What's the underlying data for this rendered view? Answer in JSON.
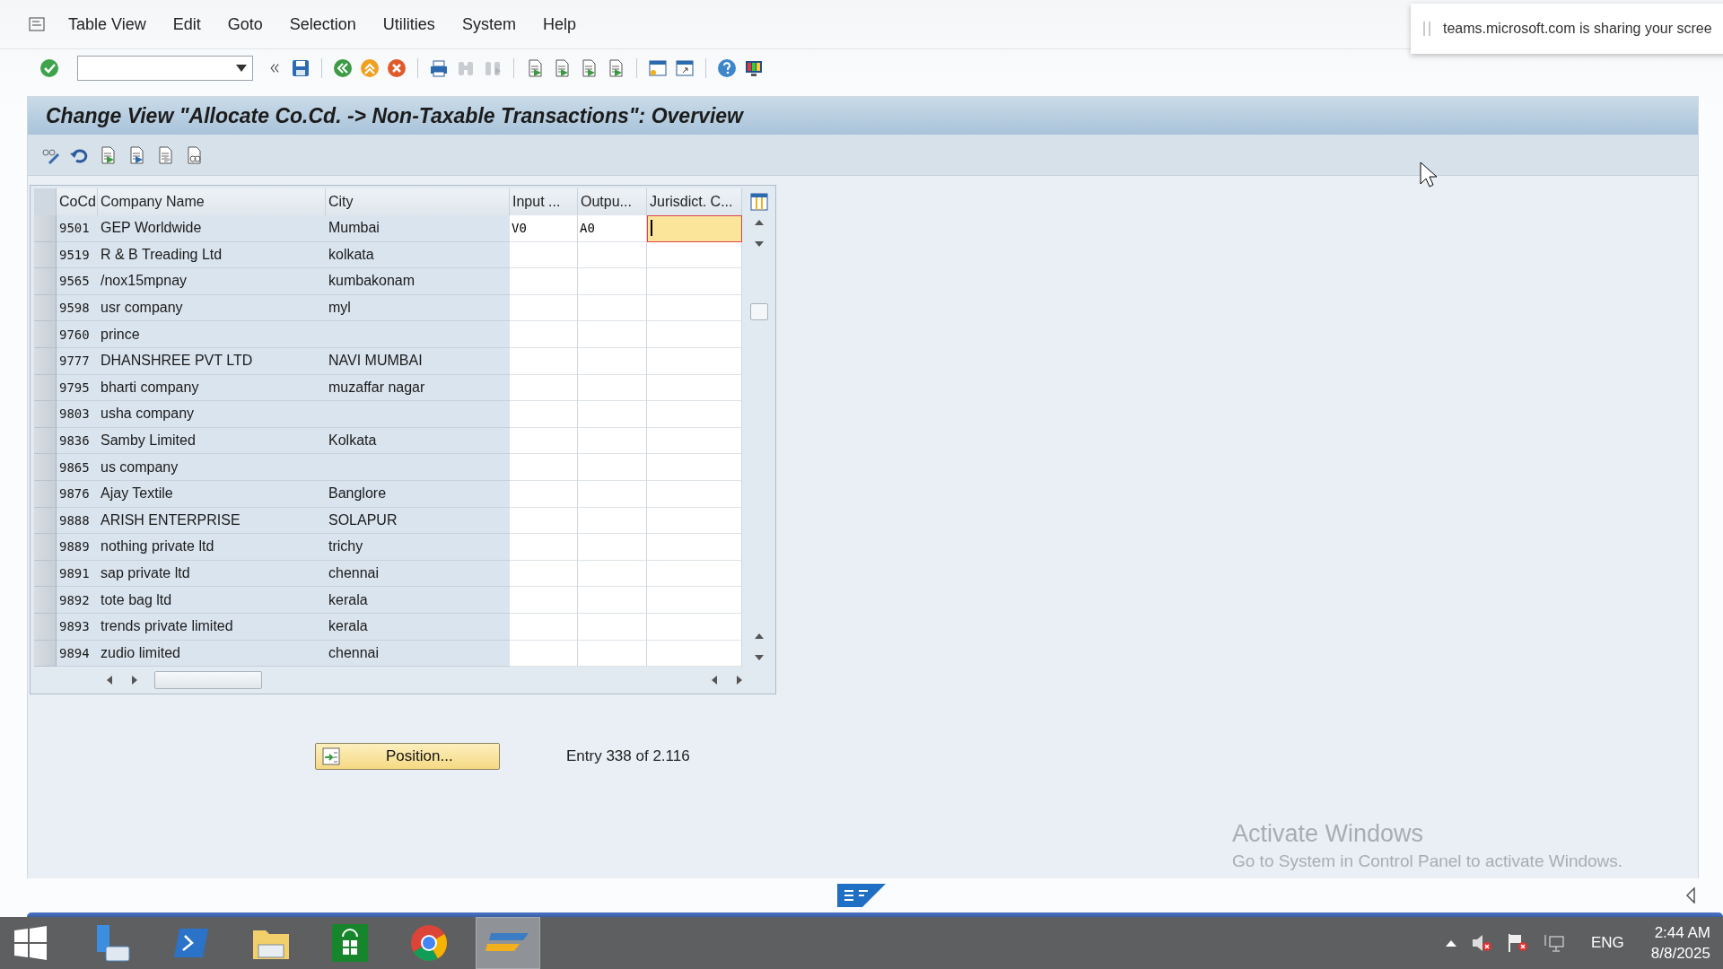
{
  "menu": [
    "Table View",
    "Edit",
    "Goto",
    "Selection",
    "Utilities",
    "System",
    "Help"
  ],
  "title": "Change View \"Allocate Co.Cd. -> Non-Taxable Transactions\": Overview",
  "table": {
    "columns": [
      "CoCd",
      "Company Name",
      "City",
      "Input ...",
      "Outpu...",
      "Jurisdict. C..."
    ],
    "rows": [
      {
        "cocd": "9501",
        "name": "GEP Worldwide",
        "city": "Mumbai",
        "input": "V0",
        "output": "A0",
        "jurisdiction_focused": true
      },
      {
        "cocd": "9519",
        "name": "R & B Treading Ltd",
        "city": "kolkata",
        "jurisdiction_focused": false
      },
      {
        "cocd": "9565",
        "name": "/nox15mpnay",
        "city": "kumbakonam",
        "jurisdiction_focused": false
      },
      {
        "cocd": "9598",
        "name": "usr company",
        "city": "myl",
        "jurisdiction_focused": false
      },
      {
        "cocd": "9760",
        "name": "prince",
        "jurisdiction_focused": false
      },
      {
        "cocd": "9777",
        "name": "DHANSHREE PVT LTD",
        "city": "NAVI MUMBAI",
        "jurisdiction_focused": false
      },
      {
        "cocd": "9795",
        "name": "bharti company",
        "city": "muzaffar nagar",
        "jurisdiction_focused": false
      },
      {
        "cocd": "9803",
        "name": "usha company",
        "jurisdiction_focused": false
      },
      {
        "cocd": "9836",
        "name": "Samby Limited",
        "city": "Kolkata",
        "jurisdiction_focused": false
      },
      {
        "cocd": "9865",
        "name": "us company",
        "jurisdiction_focused": false
      },
      {
        "cocd": "9876",
        "name": "Ajay Textile",
        "city": "Banglore",
        "jurisdiction_focused": false
      },
      {
        "cocd": "9888",
        "name": "ARISH ENTERPRISE",
        "city": "SOLAPUR",
        "jurisdiction_focused": false
      },
      {
        "cocd": "9889",
        "name": "nothing private ltd",
        "city": "trichy",
        "jurisdiction_focused": false
      },
      {
        "cocd": "9891",
        "name": "sap private ltd",
        "city": "chennai",
        "jurisdiction_focused": false
      },
      {
        "cocd": "9892",
        "name": "tote bag ltd",
        "city": "kerala",
        "jurisdiction_focused": false
      },
      {
        "cocd": "9893",
        "name": "trends private limited",
        "city": "kerala",
        "jurisdiction_focused": false
      },
      {
        "cocd": "9894",
        "name": "zudio limited",
        "city": "chennai",
        "jurisdiction_focused": false
      }
    ]
  },
  "position_button": "Position...",
  "entry_info": "Entry 338 of 2.116",
  "notification": "teams.microsoft.com is sharing your scree",
  "activation": {
    "title": "Activate Windows",
    "text": "Go to System in Control Panel to activate Windows."
  },
  "taskbar": {
    "apps": [
      {
        "kind": "server",
        "selected": false
      },
      {
        "kind": "shell",
        "selected": false
      },
      {
        "kind": "folder",
        "selected": false
      },
      {
        "kind": "store",
        "selected": false
      },
      {
        "kind": "chrome",
        "selected": false
      },
      {
        "kind": "sap",
        "selected": true
      }
    ],
    "language": "ENG",
    "time": "2:44 AM",
    "date": "8/8/2025"
  }
}
